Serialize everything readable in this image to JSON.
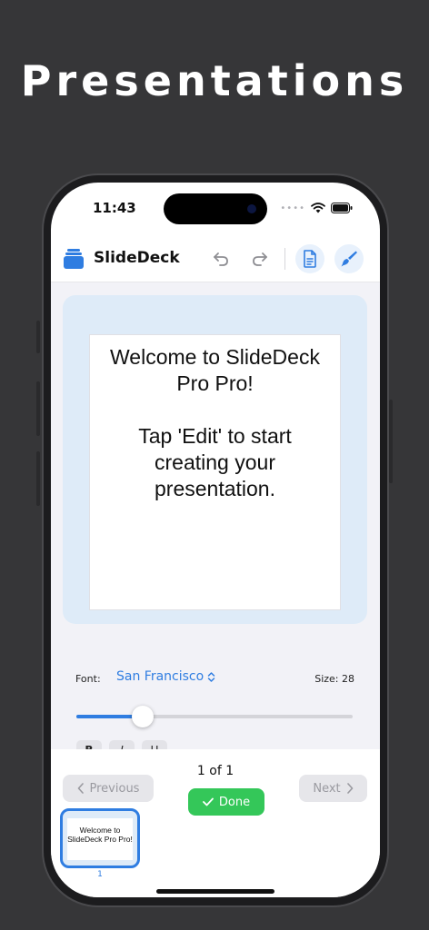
{
  "hero": {
    "title": "Presentations"
  },
  "status": {
    "time": "11:43",
    "cellular": "••••"
  },
  "app": {
    "name": "SlideDeck",
    "icons": {
      "app": "stack-icon",
      "undo": "undo-icon",
      "redo": "redo-icon",
      "doc": "document-icon",
      "brush": "paintbrush-icon"
    },
    "accent": "#2f7de1"
  },
  "slide": {
    "lines": [
      "Welcome to SlideDeck",
      "Pro Pro!",
      "Tap 'Edit' to start",
      "creating your",
      "presentation."
    ]
  },
  "controls": {
    "font_label": "Font:",
    "font_value": "San Francisco",
    "size_label": "Size: 28",
    "slider_value": 0.24,
    "style_buttons": [
      "B",
      "I",
      "U"
    ]
  },
  "pager": {
    "count": "1 of 1",
    "previous": "Previous",
    "next": "Next",
    "done": "Done",
    "done_color": "#34c759"
  },
  "thumbnail": {
    "text": "Welcome to SlideDeck Pro Pro!",
    "number": "1"
  }
}
